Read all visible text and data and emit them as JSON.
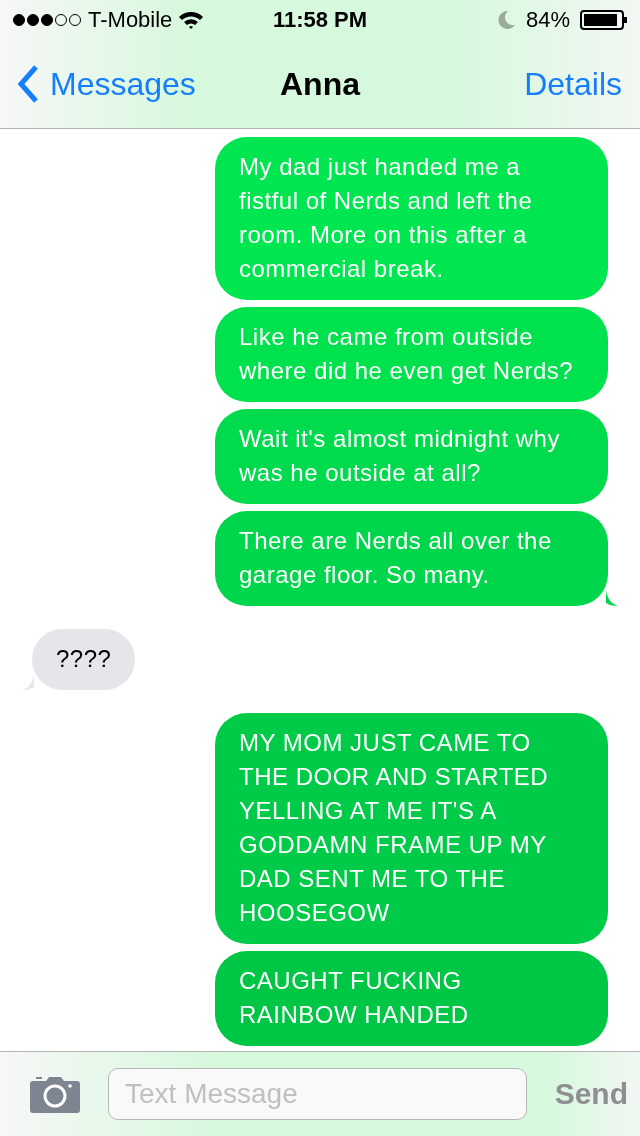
{
  "status_bar": {
    "carrier": "T-Mobile",
    "time": "11:58 PM",
    "battery": "84%"
  },
  "nav": {
    "back": "Messages",
    "title": "Anna",
    "action": "Details"
  },
  "messages": [
    {
      "kind": "sent",
      "text": "My dad just handed me a fistful of Nerds and left the room. More on this after a commercial break.",
      "tail": false
    },
    {
      "kind": "sent",
      "text": "Like he came from outside where did he even get Nerds?",
      "tail": false
    },
    {
      "kind": "sent",
      "text": "Wait it's almost midnight why was he outside at all?",
      "tail": false
    },
    {
      "kind": "sent",
      "text": "There are Nerds all over the garage floor. So many.",
      "tail": true
    },
    {
      "kind": "received",
      "text": "????",
      "tail": true
    },
    {
      "kind": "sent",
      "text": "MY MOM JUST CAME TO THE DOOR AND STARTED YELLING AT ME IT'S A GODDAMN FRAME UP MY DAD SENT ME TO THE HOOSEGOW",
      "tail": false
    },
    {
      "kind": "sent",
      "text": "CAUGHT FUCKING RAINBOW HANDED",
      "tail": false
    }
  ],
  "composer": {
    "placeholder": "Text Message",
    "send": "Send"
  }
}
